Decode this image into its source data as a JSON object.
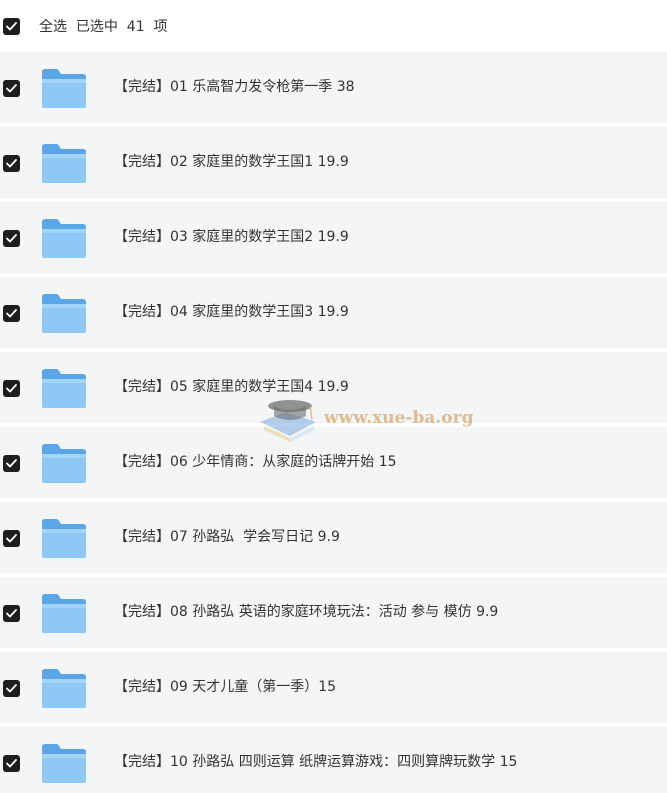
{
  "header": {
    "select_all_text": "全选  已选中  41  项",
    "checked": true
  },
  "items": [
    {
      "label": "【完结】01 乐高智力发令枪第一季 38",
      "checked": true,
      "icon": "folder-icon"
    },
    {
      "label": "【完结】02 家庭里的数学王国1 19.9",
      "checked": true,
      "icon": "folder-icon"
    },
    {
      "label": "【完结】03 家庭里的数学王国2 19.9",
      "checked": true,
      "icon": "folder-icon"
    },
    {
      "label": "【完结】04 家庭里的数学王国3 19.9",
      "checked": true,
      "icon": "folder-icon"
    },
    {
      "label": "【完结】05 家庭里的数学王国4 19.9",
      "checked": true,
      "icon": "folder-icon"
    },
    {
      "label": "【完结】06 少年情商：从家庭的话牌开始 15",
      "checked": true,
      "icon": "folder-icon"
    },
    {
      "label": "【完结】07 孙路弘  学会写日记 9.9",
      "checked": true,
      "icon": "folder-icon"
    },
    {
      "label": "【完结】08 孙路弘 英语的家庭环境玩法：活动 参与 模仿 9.9",
      "checked": true,
      "icon": "folder-icon"
    },
    {
      "label": "【完结】09 天才儿童（第一季）15",
      "checked": true,
      "icon": "folder-icon"
    },
    {
      "label": "【完结】10 孙路弘 四则运算 纸牌运算游戏：四则算牌玩数学 15",
      "checked": true,
      "icon": "folder-icon"
    }
  ],
  "watermark": {
    "text": "www.xue-ba.org"
  },
  "colors": {
    "row_background": "#f4f5f6",
    "checkbox": "#1e1e1e",
    "folder": "#7fbef0",
    "text": "#333333"
  }
}
